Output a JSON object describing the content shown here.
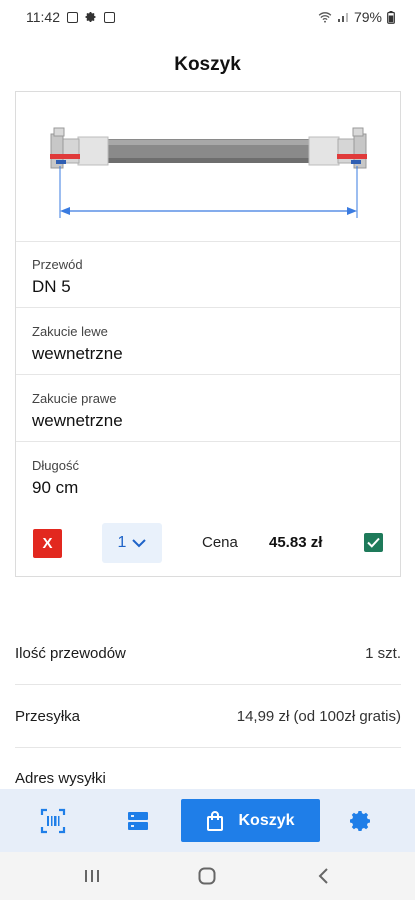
{
  "status_bar": {
    "time": "11:42",
    "battery": "79%"
  },
  "page": {
    "title": "Koszyk"
  },
  "cart_item": {
    "fields": [
      {
        "label": "Przewód",
        "value": "DN 5"
      },
      {
        "label": "Zakucie lewe",
        "value": "wewnetrzne"
      },
      {
        "label": "Zakucie prawe",
        "value": "wewnetrzne"
      },
      {
        "label": "Długość",
        "value": "90 cm"
      }
    ],
    "delete_label": "X",
    "quantity": "1",
    "price_label": "Cena",
    "price_value": "45.83 zł",
    "selected": true
  },
  "summary": {
    "hose_count_label": "Ilość przewodów",
    "hose_count_value": "1 szt.",
    "shipping_label": "Przesyłka",
    "shipping_value": "14,99 zł (od 100zł gratis)",
    "address_label": "Adres wysyłki"
  },
  "bottom_nav": {
    "items": [
      {
        "icon": "barcode-scanner-icon"
      },
      {
        "icon": "list-icon"
      },
      {
        "icon": "shopping-bag-icon",
        "label": "Koszyk",
        "active": true
      },
      {
        "icon": "gear-icon"
      }
    ]
  },
  "colors": {
    "accent": "#1f7ee8",
    "nav_background": "#e7eef9",
    "delete": "#e2281f",
    "check": "#1e7a5a"
  }
}
